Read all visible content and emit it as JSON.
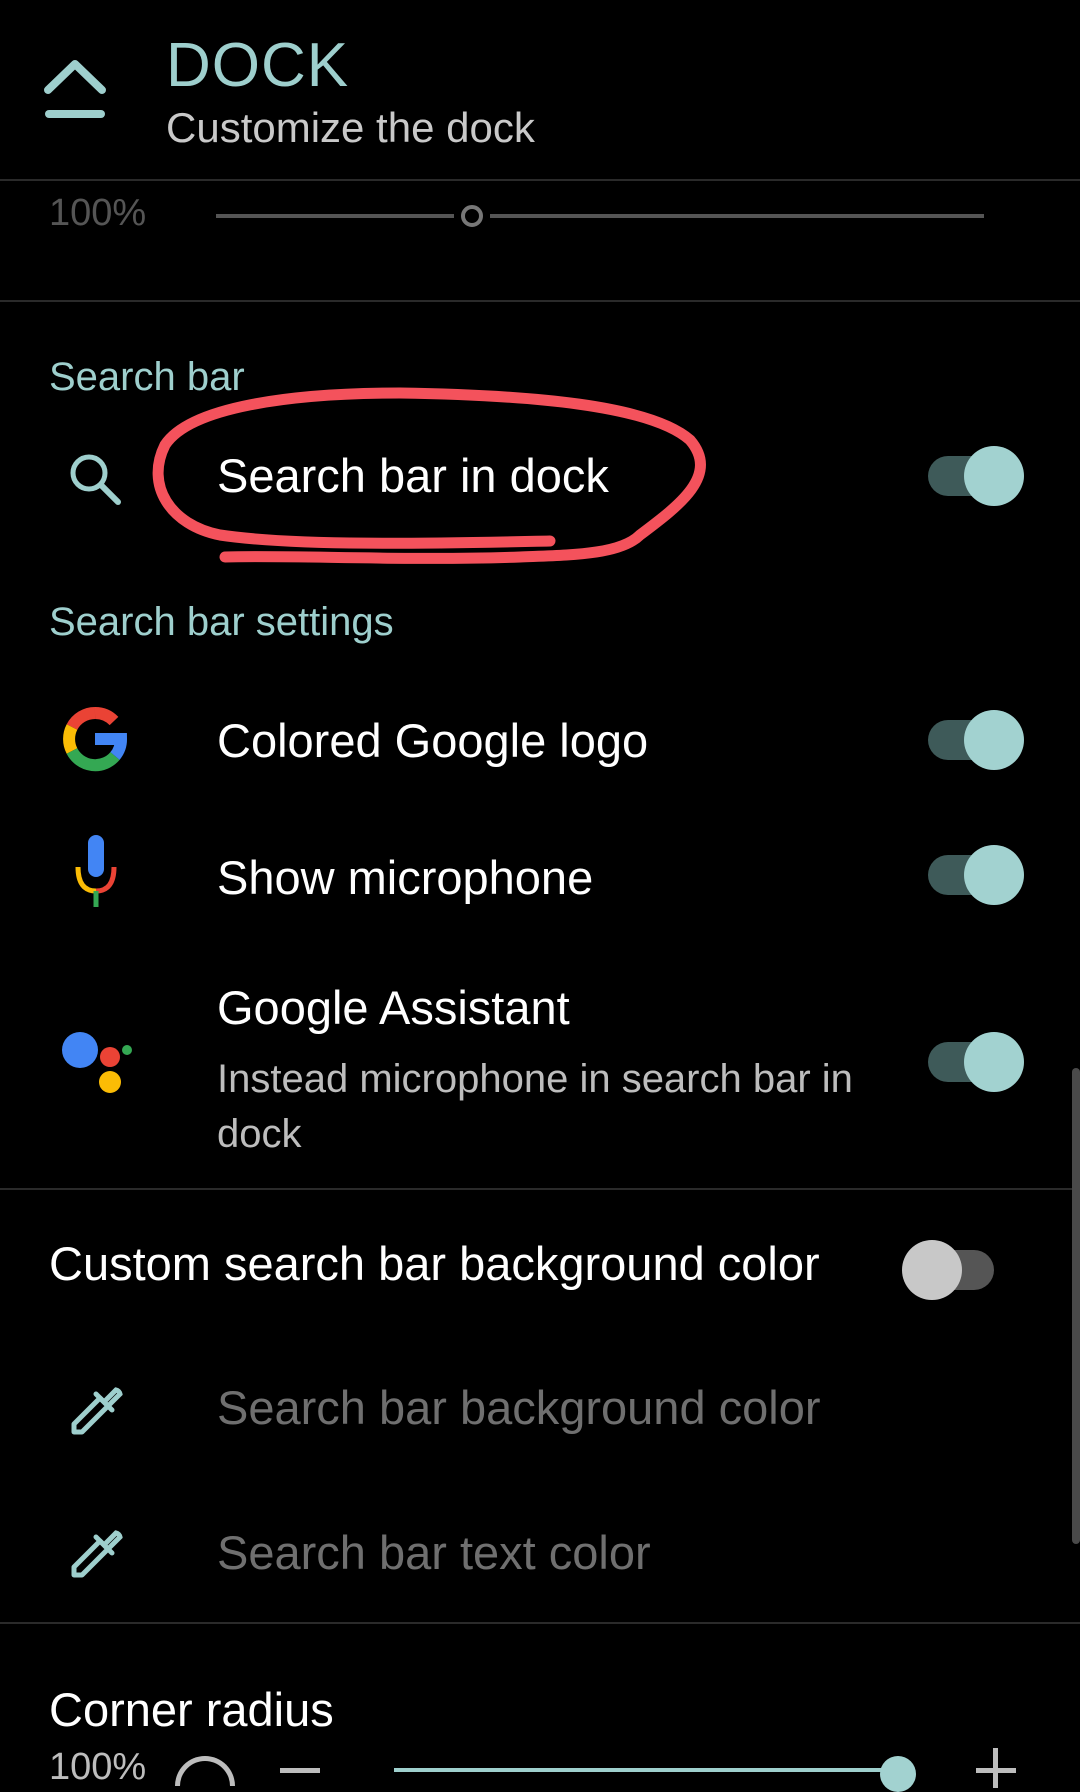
{
  "header": {
    "title": "DOCK",
    "subtitle": "Customize the dock"
  },
  "top_slider": {
    "value_label": "100%"
  },
  "search_bar_section": {
    "title": "Search bar",
    "search_bar_in_dock": {
      "label": "Search bar in dock",
      "enabled": true
    }
  },
  "search_bar_settings": {
    "title": "Search bar settings",
    "items": [
      {
        "label": "Colored Google logo",
        "enabled": true
      },
      {
        "label": "Show microphone",
        "enabled": true
      },
      {
        "label": "Google Assistant",
        "sub": "Instead microphone in search bar in dock",
        "enabled": true
      }
    ]
  },
  "custom_bg": {
    "label": "Custom search bar background color",
    "enabled": false
  },
  "color_items": [
    {
      "label": "Search bar background color"
    },
    {
      "label": "Search bar text color"
    }
  ],
  "corner_radius": {
    "label": "Corner radius",
    "value_label": "100%"
  },
  "colors": {
    "accent": "#9ecfcd",
    "toggle_thumb_on": "#a2d2d0",
    "annotation": "#f4525c"
  }
}
